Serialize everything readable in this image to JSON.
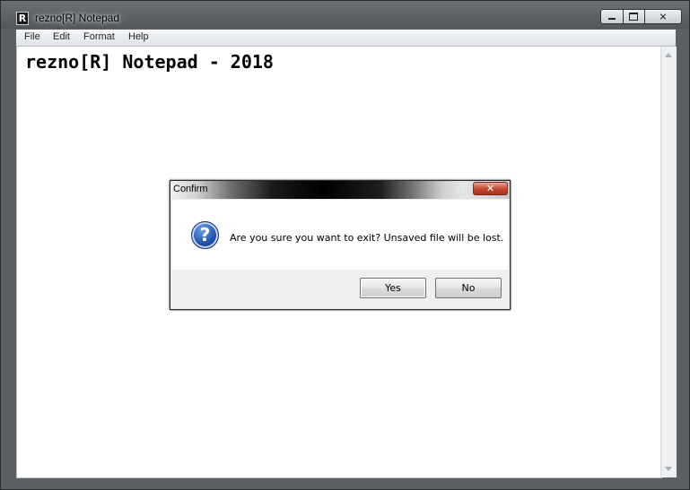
{
  "window": {
    "app_icon": "R",
    "title": "rezno[R] Notepad",
    "controls": {
      "minimize_icon": "minimize-icon",
      "maximize_icon": "maximize-icon",
      "close_glyph": "✕"
    }
  },
  "menu": {
    "items": [
      "File",
      "Edit",
      "Format",
      "Help"
    ]
  },
  "editor": {
    "text": "rezno[R] Notepad - 2018"
  },
  "dialog": {
    "title": "Confirm",
    "close_glyph": "✕",
    "icon": "question-icon",
    "icon_glyph": "?",
    "message": "Are you sure you want to exit? Unsaved file will be lost.",
    "buttons": {
      "yes": "Yes",
      "no": "No"
    }
  },
  "colors": {
    "frame": "#5b6065",
    "dialog_close": "#c2452f",
    "question_icon": "#1d4fa8"
  }
}
